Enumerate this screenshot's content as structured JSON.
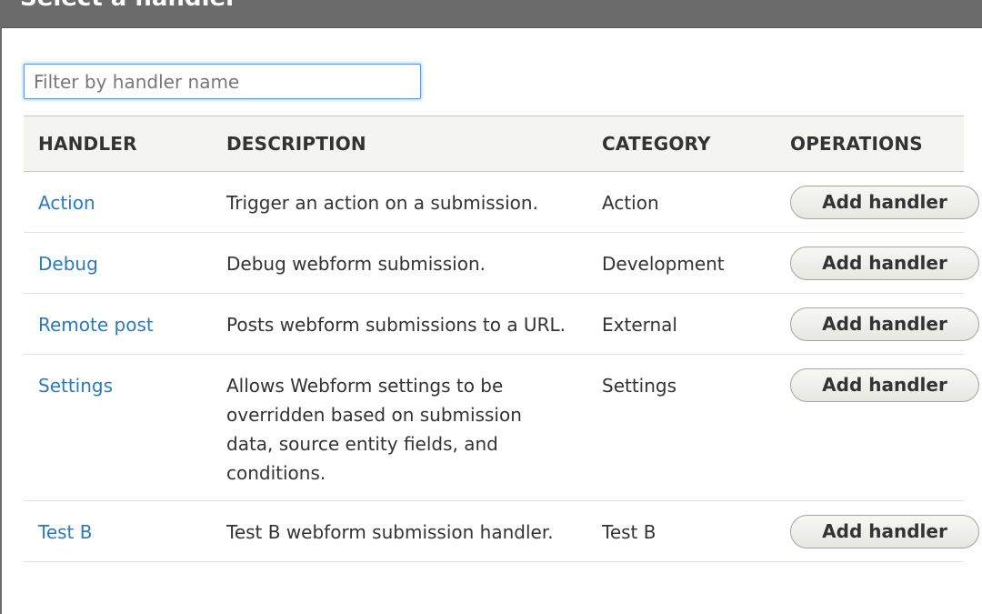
{
  "dialog": {
    "title": "Select a handler"
  },
  "filter": {
    "placeholder": "Filter by handler name",
    "value": ""
  },
  "table": {
    "headers": {
      "handler": "HANDLER",
      "description": "DESCRIPTION",
      "category": "CATEGORY",
      "operations": "OPERATIONS"
    },
    "rows": [
      {
        "handler": "Action",
        "description": "Trigger an action on a submission.",
        "category": "Action",
        "button": "Add handler"
      },
      {
        "handler": "Debug",
        "description": "Debug webform submission.",
        "category": "Development",
        "button": "Add handler"
      },
      {
        "handler": "Remote post",
        "description": "Posts webform submissions to a URL.",
        "category": "External",
        "button": "Add handler"
      },
      {
        "handler": "Settings",
        "description": "Allows Webform settings to be overridden based on submission data, source entity fields, and conditions.",
        "category": "Settings",
        "button": "Add handler"
      },
      {
        "handler": "Test B",
        "description": "Test B webform submission handler.",
        "category": "Test B",
        "button": "Add handler"
      }
    ]
  },
  "colors": {
    "titlebar": "#6b6b6b",
    "link": "#2a7ac0",
    "header_bg": "#f4f4f0",
    "focus": "#40a0ff"
  }
}
